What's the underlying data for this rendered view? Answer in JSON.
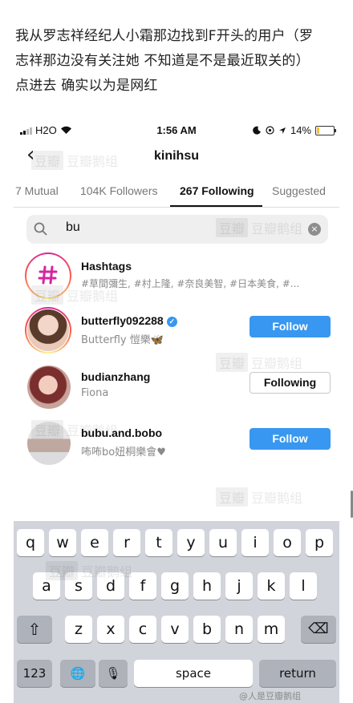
{
  "caption": {
    "line1": "我从罗志祥经纪人小霜那边找到F开头的用户（罗",
    "line2": "志祥那边没有关注她 不知道是不是最近取关的）",
    "line3": "点进去 确实以为是网红"
  },
  "status_bar": {
    "carrier": "H2O",
    "time": "1:56 AM",
    "battery": "14%"
  },
  "header": {
    "back_glyph": "‹",
    "title": "kinihsu"
  },
  "tabs": [
    "7 Mutual",
    "104K Followers",
    "267 Following",
    "Suggested"
  ],
  "active_tab": "267 Following",
  "search": {
    "value": "bu",
    "clear_glyph": "×"
  },
  "results": [
    {
      "name": "Hashtags",
      "sub": "#草間彌生, #村上隆, #奈良美智, #日本美食, #...",
      "button": ""
    },
    {
      "name": "butterfly092288",
      "sub": "Butterfly 愷樂🦋",
      "verified": true,
      "button": "Follow"
    },
    {
      "name": "budianzhang",
      "sub": "Fiona",
      "button": "Following"
    },
    {
      "name": "bubu.and.bobo",
      "sub": "咘咘bo妞桐樂會♥",
      "button": "Follow"
    }
  ],
  "keyboard": {
    "row1": [
      "q",
      "w",
      "e",
      "r",
      "t",
      "y",
      "u",
      "i",
      "o",
      "p"
    ],
    "row2": [
      "a",
      "s",
      "d",
      "f",
      "g",
      "h",
      "j",
      "k",
      "l"
    ],
    "row3": [
      "z",
      "x",
      "c",
      "v",
      "b",
      "n",
      "m"
    ],
    "shift": "⇧",
    "delete": "⌫",
    "numbers": "123",
    "globe": "🌐",
    "mic": "🎙",
    "space": "space",
    "return": "return"
  },
  "watermark": {
    "badge": "豆瓣",
    "text": "豆瓣鹅组"
  },
  "bottom_watermark": "@人是豆瓣鹅组",
  "colors": {
    "follow_blue": "#3897f0",
    "keyboard_bg": "#d1d4da",
    "text_gray": "#8a8a8a"
  }
}
